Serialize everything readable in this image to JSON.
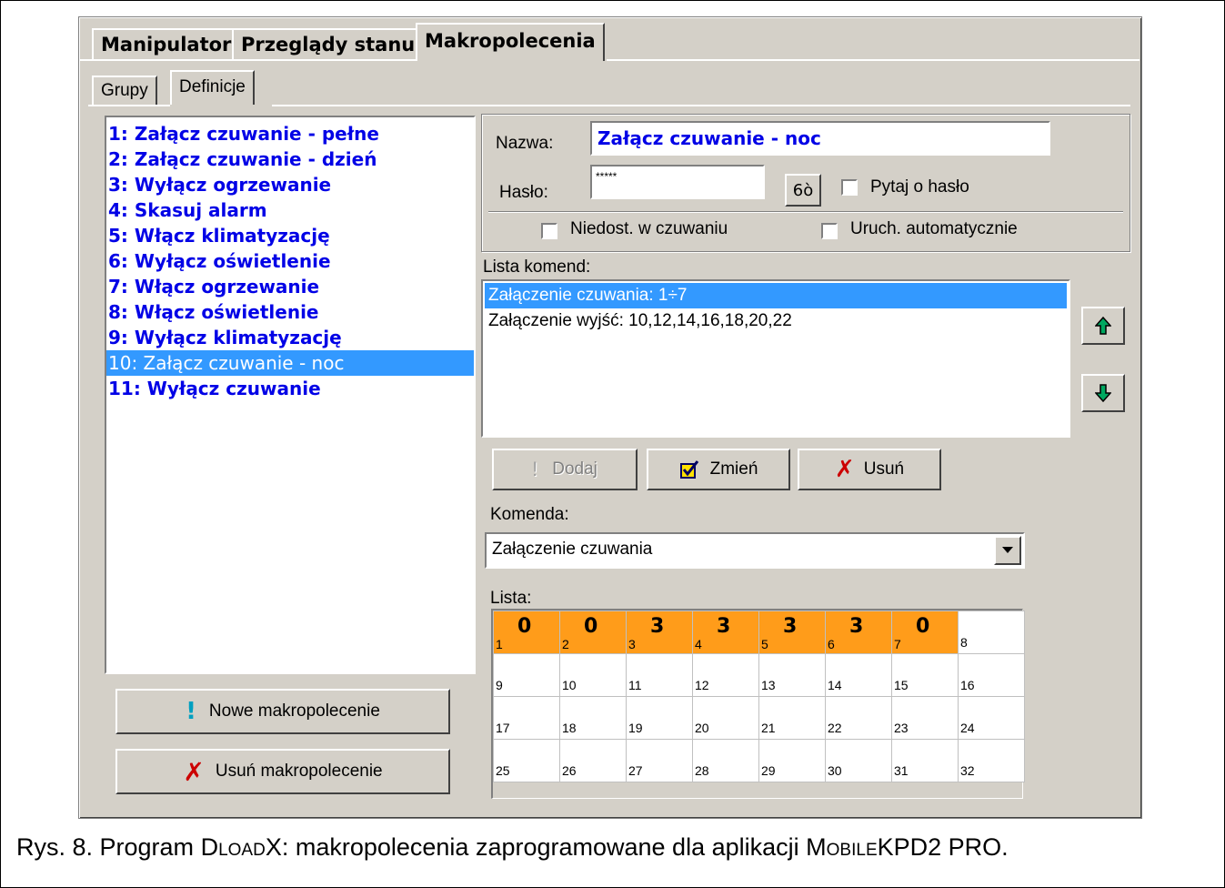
{
  "tabs": {
    "main": [
      "Manipulator",
      "Przeglądy stanu",
      "Makropolecenia"
    ],
    "sub": [
      "Grupy",
      "Definicje"
    ]
  },
  "macros": [
    "1: Załącz czuwanie - pełne",
    "2: Załącz czuwanie - dzień",
    "3: Wyłącz ogrzewanie",
    "4: Skasuj alarm",
    "5: Włącz klimatyzację",
    "6: Wyłącz oświetlenie",
    "7: Włącz ogrzewanie",
    "8: Włącz oświetlenie",
    "9: Wyłącz klimatyzację",
    "10: Załącz czuwanie - noc",
    "11: Wyłącz czuwanie"
  ],
  "selected_macro": 9,
  "buttons": {
    "new_macro": "Nowe makropolecenie",
    "delete_macro": "Usuń makropolecenie",
    "add": "Dodaj",
    "change": "Zmień",
    "remove": "Usuń"
  },
  "form": {
    "name_label": "Nazwa:",
    "name_value": "Załącz czuwanie - noc",
    "password_label": "Hasło:",
    "password_value": "*****",
    "show_password_glyph": "6ò",
    "ask_password": "Pytaj o hasło",
    "unavailable_armed": "Niedost. w czuwaniu",
    "auto_run": "Uruch. automatycznie"
  },
  "commands": {
    "label": "Lista komend:",
    "items": [
      "Załączenie czuwania: 1÷7",
      "Załączenie wyjść: 10,12,14,16,18,20,22"
    ],
    "selected": 0
  },
  "command_select": {
    "label": "Komenda:",
    "value": "Załączenie czuwania"
  },
  "list": {
    "label": "Lista:",
    "cells": [
      {
        "n": "1",
        "v": "0"
      },
      {
        "n": "2",
        "v": "0"
      },
      {
        "n": "3",
        "v": "3"
      },
      {
        "n": "4",
        "v": "3"
      },
      {
        "n": "5",
        "v": "3"
      },
      {
        "n": "6",
        "v": "3"
      },
      {
        "n": "7",
        "v": "0"
      },
      {
        "n": "8",
        "v": ""
      },
      {
        "n": "9",
        "v": ""
      },
      {
        "n": "10",
        "v": ""
      },
      {
        "n": "11",
        "v": ""
      },
      {
        "n": "12",
        "v": ""
      },
      {
        "n": "13",
        "v": ""
      },
      {
        "n": "14",
        "v": ""
      },
      {
        "n": "15",
        "v": ""
      },
      {
        "n": "16",
        "v": ""
      },
      {
        "n": "17",
        "v": ""
      },
      {
        "n": "18",
        "v": ""
      },
      {
        "n": "19",
        "v": ""
      },
      {
        "n": "20",
        "v": ""
      },
      {
        "n": "21",
        "v": ""
      },
      {
        "n": "22",
        "v": ""
      },
      {
        "n": "23",
        "v": ""
      },
      {
        "n": "24",
        "v": ""
      },
      {
        "n": "25",
        "v": ""
      },
      {
        "n": "26",
        "v": ""
      },
      {
        "n": "27",
        "v": ""
      },
      {
        "n": "28",
        "v": ""
      },
      {
        "n": "29",
        "v": ""
      },
      {
        "n": "30",
        "v": ""
      },
      {
        "n": "31",
        "v": ""
      },
      {
        "n": "32",
        "v": ""
      }
    ]
  },
  "caption": {
    "pre": "Rys. 8. Program ",
    "dload_d": "D",
    "dload_rest": "LOAD",
    "dload_x": "X",
    "mid": ": makropolecenia zaprogramowane dla aplikacji ",
    "mobile_m": "M",
    "mobile_rest": "OBILE",
    "post": "KPD2 PRO."
  },
  "colors": {
    "selection": "#3399ff",
    "macro_text": "#0000e6",
    "active_cell": "#ff9c1a",
    "face": "#d4d0c8"
  }
}
